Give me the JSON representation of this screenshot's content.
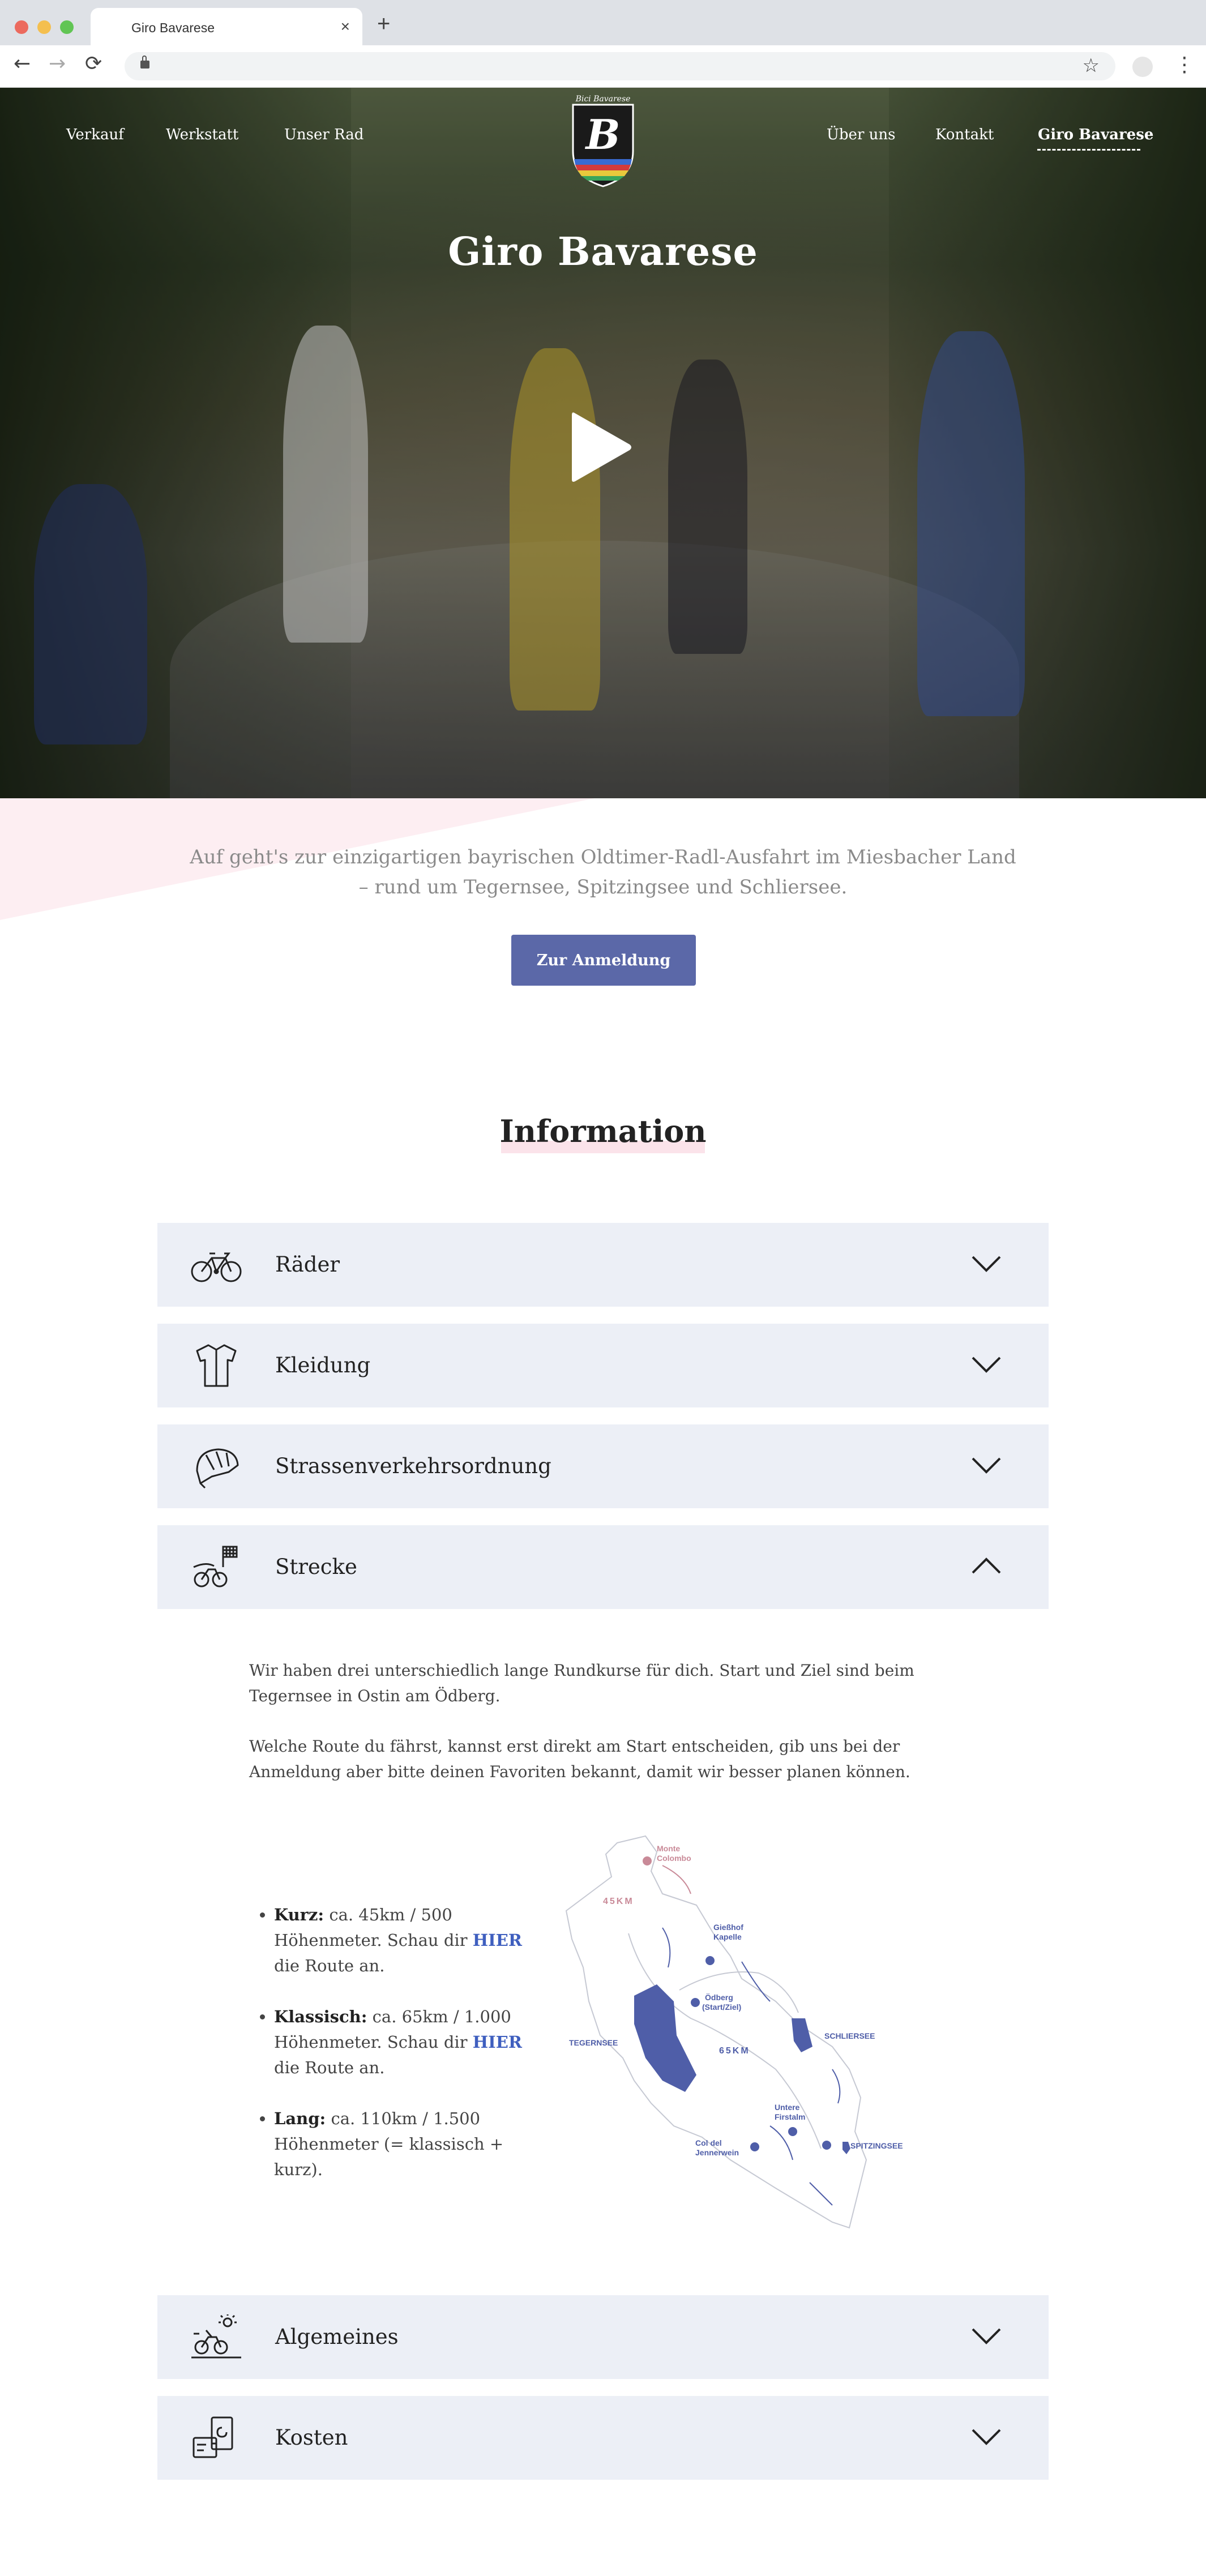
{
  "browser": {
    "tab_title": "Giro Bavarese",
    "tab_close": "×",
    "new_tab": "+",
    "url": "",
    "back": "←",
    "forward": "→",
    "reload": "⟳",
    "star": "☆",
    "menu": "⋮",
    "traffic_colors": [
      "#ec6a5e",
      "#f4bf4f",
      "#61c554"
    ]
  },
  "nav": {
    "left": [
      "Verkauf",
      "Werkstatt",
      "Unser Rad"
    ],
    "right": [
      "Über uns",
      "Kontakt",
      "Giro Bavarese"
    ],
    "active": "Giro Bavarese"
  },
  "hero": {
    "title": "Giro Bavarese",
    "logo_text": "Bici Bavarese"
  },
  "intro": {
    "text": "Auf geht's zur einzigartigen bayrischen Oldtimer-Radl-Ausfahrt im Miesbacher Land – rund um Tegernsee, Spitzingsee und Schliersee.",
    "cta": "Zur Anmeldung"
  },
  "information": {
    "title": "Information",
    "items": [
      {
        "label": "Räder",
        "icon": "bicycle-icon",
        "state": "collapsed"
      },
      {
        "label": "Kleidung",
        "icon": "jersey-icon",
        "state": "collapsed"
      },
      {
        "label": "Strassenverkehrsordnung",
        "icon": "helmet-icon",
        "state": "collapsed"
      },
      {
        "label": "Strecke",
        "icon": "route-icon",
        "state": "expanded"
      },
      {
        "label": "Algemeines",
        "icon": "cyclist-sun-icon",
        "state": "collapsed"
      },
      {
        "label": "Kosten",
        "icon": "money-icon",
        "state": "collapsed"
      }
    ],
    "strecke": {
      "p1": "Wir haben drei unterschiedlich lange Rundkurse für dich. Start und Ziel sind beim Tegernsee in Ostin am Ödberg.",
      "p2": "Welche Route du fährst, kannst erst direkt am Start entscheiden, gib uns bei der Anmeldung aber bitte deinen Favoriten bekannt, damit wir besser planen können.",
      "routes": [
        {
          "name": "Kurz:",
          "pre": " ca. 45km / 500 Höhenmeter. Schau dir ",
          "link": "HIER",
          "post": " die Route an."
        },
        {
          "name": "Klassisch:",
          "pre": " ca. 65km / 1.000 Höhenmeter. Schau dir ",
          "link": "HIER",
          "post": " die Route an."
        },
        {
          "name": "Lang:",
          "pre": " ca. 110km / 1.500 Höhenmeter (= klassisch + kurz).",
          "link": "",
          "post": ""
        }
      ],
      "map": {
        "labels": {
          "monte": [
            "Monte",
            "Colombo"
          ],
          "km45": "45KM",
          "giesshof": [
            "Gießhof",
            "Kapelle"
          ],
          "oedberg": [
            "Ödberg",
            "(Start/Ziel)"
          ],
          "tegernsee": "TEGERNSEE",
          "km65": "65KM",
          "schliersee": "SCHLIERSEE",
          "untere": [
            "Untere",
            "Firstalm"
          ],
          "col": [
            "Col del",
            "Jennerwein"
          ],
          "spitzingsee": "SPITZINGSEE"
        },
        "colors": {
          "accent": "#4f5ea8",
          "pink": "#c98a98"
        }
      }
    }
  },
  "colors": {
    "accent": "#5b68a8",
    "accordion_bg": "#eceff6",
    "pink": "#fbe3ea"
  }
}
